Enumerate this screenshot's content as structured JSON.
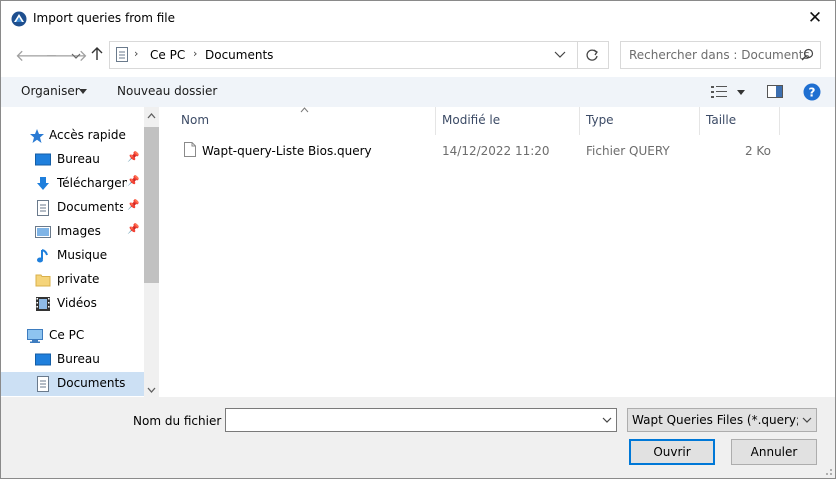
{
  "window": {
    "title": "Import queries from file",
    "close_glyph": "✕"
  },
  "address": {
    "crumbs": [
      "Ce PC",
      "Documents"
    ],
    "search_placeholder": "Rechercher dans : Documents"
  },
  "toolbar": {
    "organize": "Organiser",
    "new_folder": "Nouveau dossier"
  },
  "sidebar": {
    "items": [
      {
        "label": "Accès rapide",
        "icon": "star-icon"
      },
      {
        "label": "Bureau",
        "icon": "desktop-icon",
        "pinned": true
      },
      {
        "label": "Téléchargements",
        "icon": "download-icon",
        "pinned": true
      },
      {
        "label": "Documents",
        "icon": "document-icon",
        "pinned": true
      },
      {
        "label": "Images",
        "icon": "image-icon",
        "pinned": true
      },
      {
        "label": "Musique",
        "icon": "music-icon"
      },
      {
        "label": "private",
        "icon": "folder-icon"
      },
      {
        "label": "Vidéos",
        "icon": "video-icon"
      },
      {
        "label": "Ce PC",
        "icon": "computer-icon"
      },
      {
        "label": "Bureau",
        "icon": "desktop-icon"
      },
      {
        "label": "Documents",
        "icon": "document-icon",
        "selected": true
      }
    ]
  },
  "columns": {
    "name": "Nom",
    "modified": "Modifié le",
    "type": "Type",
    "size": "Taille"
  },
  "files": [
    {
      "name": "Wapt-query-Liste Bios.query",
      "modified": "14/12/2022 11:20",
      "type": "Fichier QUERY",
      "size": "2 Ko"
    }
  ],
  "footer": {
    "filename_label": "Nom du fichier :",
    "filename_value": "",
    "filetype": "Wapt Queries Files (*.query;*.json)",
    "open": "Ouvrir",
    "cancel": "Annuler"
  },
  "colors": {
    "accent": "#0078d7",
    "selected_bg": "#cce0f4",
    "toolbar_bg": "#f0f4f9"
  }
}
